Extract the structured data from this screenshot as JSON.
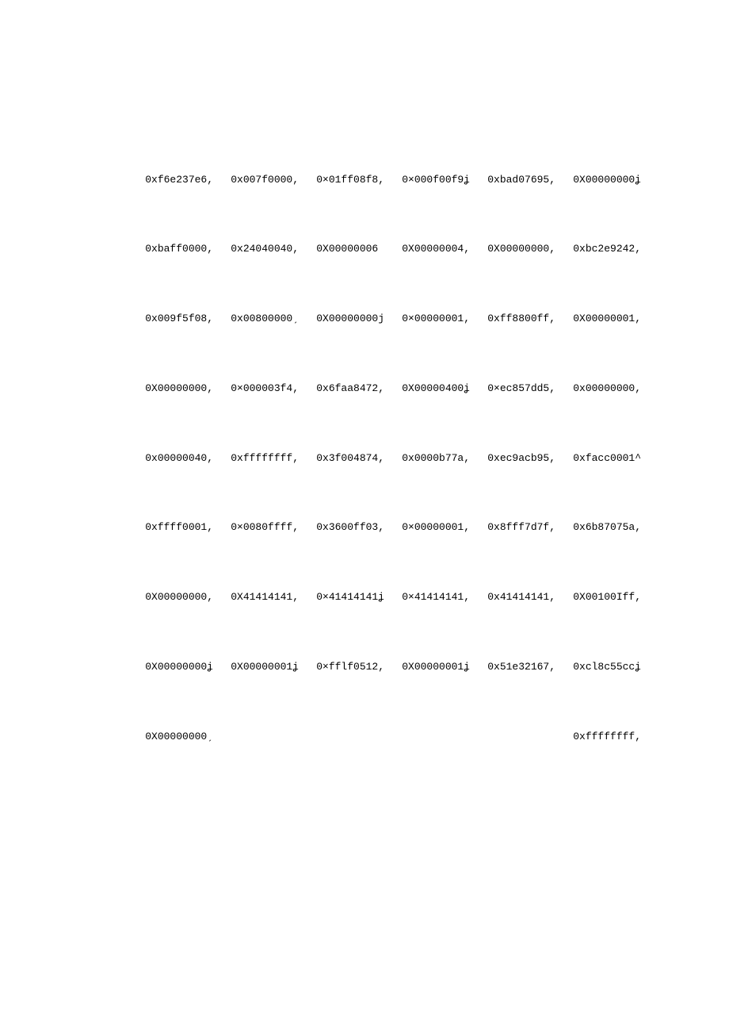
{
  "rows": [
    [
      "0xf6e237e6,",
      "0x007f0000,",
      "0×01ff08f8,",
      "0×000f00f9ʝ",
      "0xbad07695,",
      "0X00000000ʝ"
    ],
    [
      "0xbaff0000,",
      "0x24040040,",
      "0X00000006",
      "0X00000004,",
      "0X00000000,",
      "0xbc2e9242,"
    ],
    [
      "0x009f5f08,",
      "0x00800000ˏ",
      "0X00000000j",
      "0×00000001,",
      "0xff8800ff,",
      "0X00000001,"
    ],
    [
      "0X00000000,",
      "0×000003f4,",
      "0x6faa8472,",
      "0X00000400ʝ",
      "0×ec857dd5,",
      "0x00000000,"
    ],
    [
      "0x00000040,",
      "0xffffffff,",
      "0x3f004874,",
      "0x0000b77a,",
      "0xec9acb95,",
      "0xfacc0001^"
    ],
    [
      "0xffff0001,",
      "0×0080ffff,",
      "0x3600ff03,",
      "0×00000001,",
      "0x8fff7d7f,",
      "0x6b87075a,"
    ],
    [
      "0X00000000,",
      "0X41414141,",
      "0×41414141ʝ",
      "0×41414141,",
      "0x41414141,",
      "0X00100Iff,"
    ],
    [
      "0X00000000ʝ",
      "0X00000001ʝ",
      "0×fflf0512,",
      "0X00000001ʝ",
      "0x51e32167,",
      "0xcl8c55ccʝ"
    ],
    [
      "0X00000000ˏ",
      "",
      "",
      "",
      "",
      "0xffffffff,"
    ]
  ]
}
